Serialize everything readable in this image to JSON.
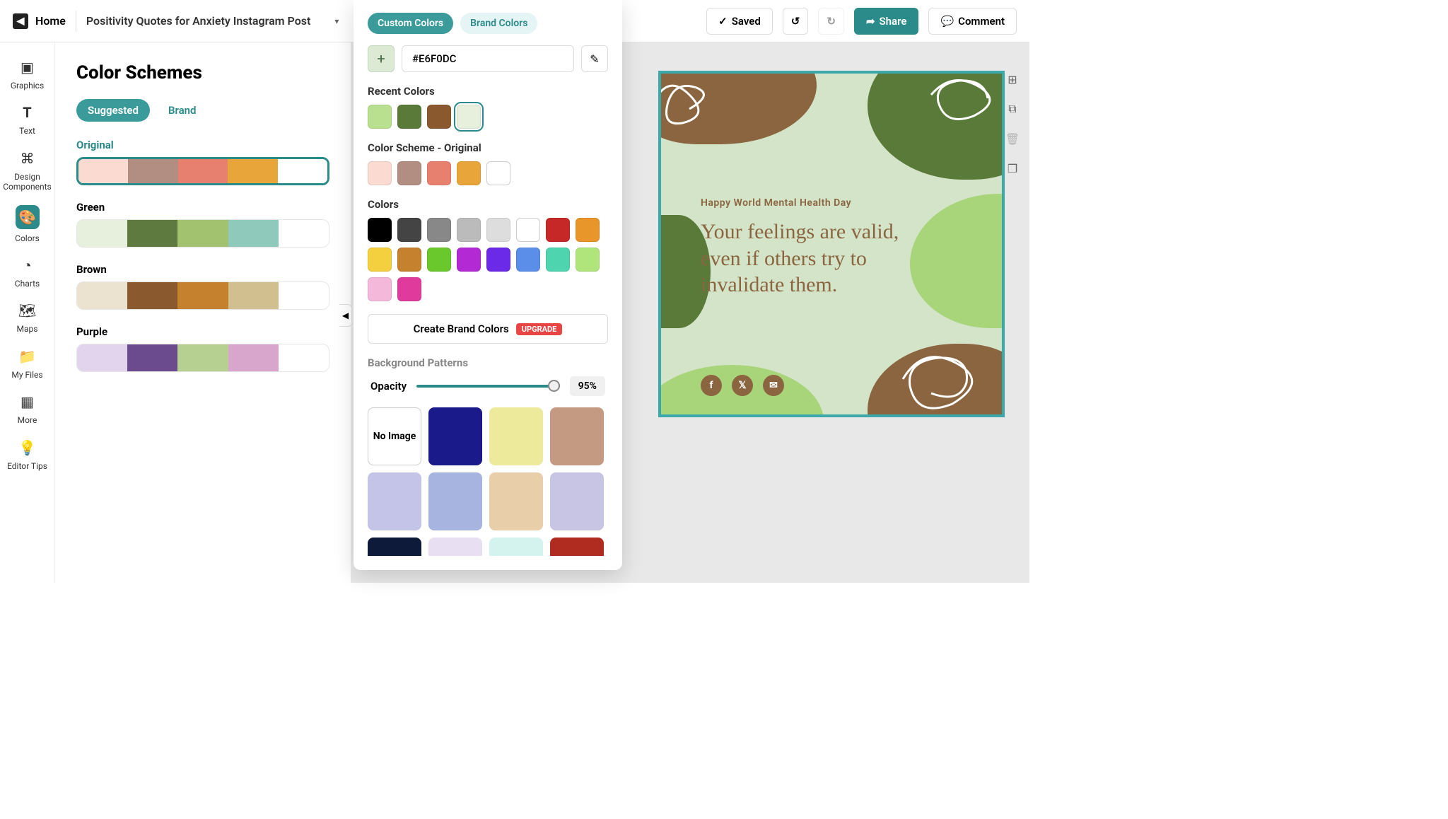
{
  "header": {
    "home": "Home",
    "title": "Positivity Quotes for Anxiety Instagram Post",
    "saved": "Saved",
    "share": "Share",
    "comment": "Comment"
  },
  "rail": {
    "graphics": "Graphics",
    "text": "Text",
    "design_components": "Design\nComponents",
    "colors": "Colors",
    "charts": "Charts",
    "maps": "Maps",
    "my_files": "My Files",
    "more": "More",
    "editor_tips": "Editor Tips"
  },
  "panel": {
    "title": "Color Schemes",
    "tab_suggested": "Suggested",
    "tab_brand": "Brand",
    "schemes": {
      "original": {
        "label": "Original",
        "colors": [
          "#fbdbd1",
          "#b18d82",
          "#e88070",
          "#e8a53a",
          "#ffffff"
        ]
      },
      "green": {
        "label": "Green",
        "colors": [
          "#e6f0dc",
          "#5e7a3f",
          "#a2c270",
          "#8ec9bb",
          "#ffffff"
        ]
      },
      "brown": {
        "label": "Brown",
        "colors": [
          "#ebe3cf",
          "#8a5a2e",
          "#c6812f",
          "#d2bf90",
          "#ffffff"
        ]
      },
      "purple": {
        "label": "Purple",
        "colors": [
          "#e3d4ee",
          "#6b4a8e",
          "#b5d090",
          "#d8a6cc",
          "#ffffff"
        ]
      }
    }
  },
  "popover": {
    "tab_custom": "Custom Colors",
    "tab_brand": "Brand Colors",
    "hex_value": "#E6F0DC",
    "recent_label": "Recent Colors",
    "recent": [
      "#b8e08f",
      "#5a7a3a",
      "#8a5a2e",
      "#e6f0dc"
    ],
    "scheme_label": "Color Scheme - Original",
    "scheme": [
      "#fbdbd1",
      "#b18d82",
      "#e88070",
      "#e8a53a",
      "#ffffff"
    ],
    "colors_label": "Colors",
    "colors": [
      "#000000",
      "#444444",
      "#888888",
      "#bbbbbb",
      "#dddddd",
      "#ffffff",
      "#c62828",
      "#e8962a",
      "#f4d03f",
      "#c6812f",
      "#6ac82c",
      "#b32ad4",
      "#6a2ae8",
      "#5a8ee8",
      "#4fd4b0",
      "#b0e57c",
      "#f4b8da",
      "#e03a9c"
    ],
    "brand_btn": "Create Brand Colors",
    "upgrade": "UPGRADE",
    "patterns_label": "Background Patterns",
    "opacity_label": "Opacity",
    "opacity_value": "95%",
    "no_image": "No Image",
    "patterns": [
      "#1a1a8a",
      "#eeea9c",
      "#c49a82",
      "#c4c4e8",
      "#a8b4e0",
      "#e8cfaa",
      "#c8c4e4",
      "#0e1a3a",
      "#e8e0f2",
      "#d4f2ee",
      "#b02c20"
    ]
  },
  "canvas": {
    "subtitle": "Happy World Mental Health Day",
    "quote": "Your feelings are valid, even if others try to invalidate them."
  }
}
